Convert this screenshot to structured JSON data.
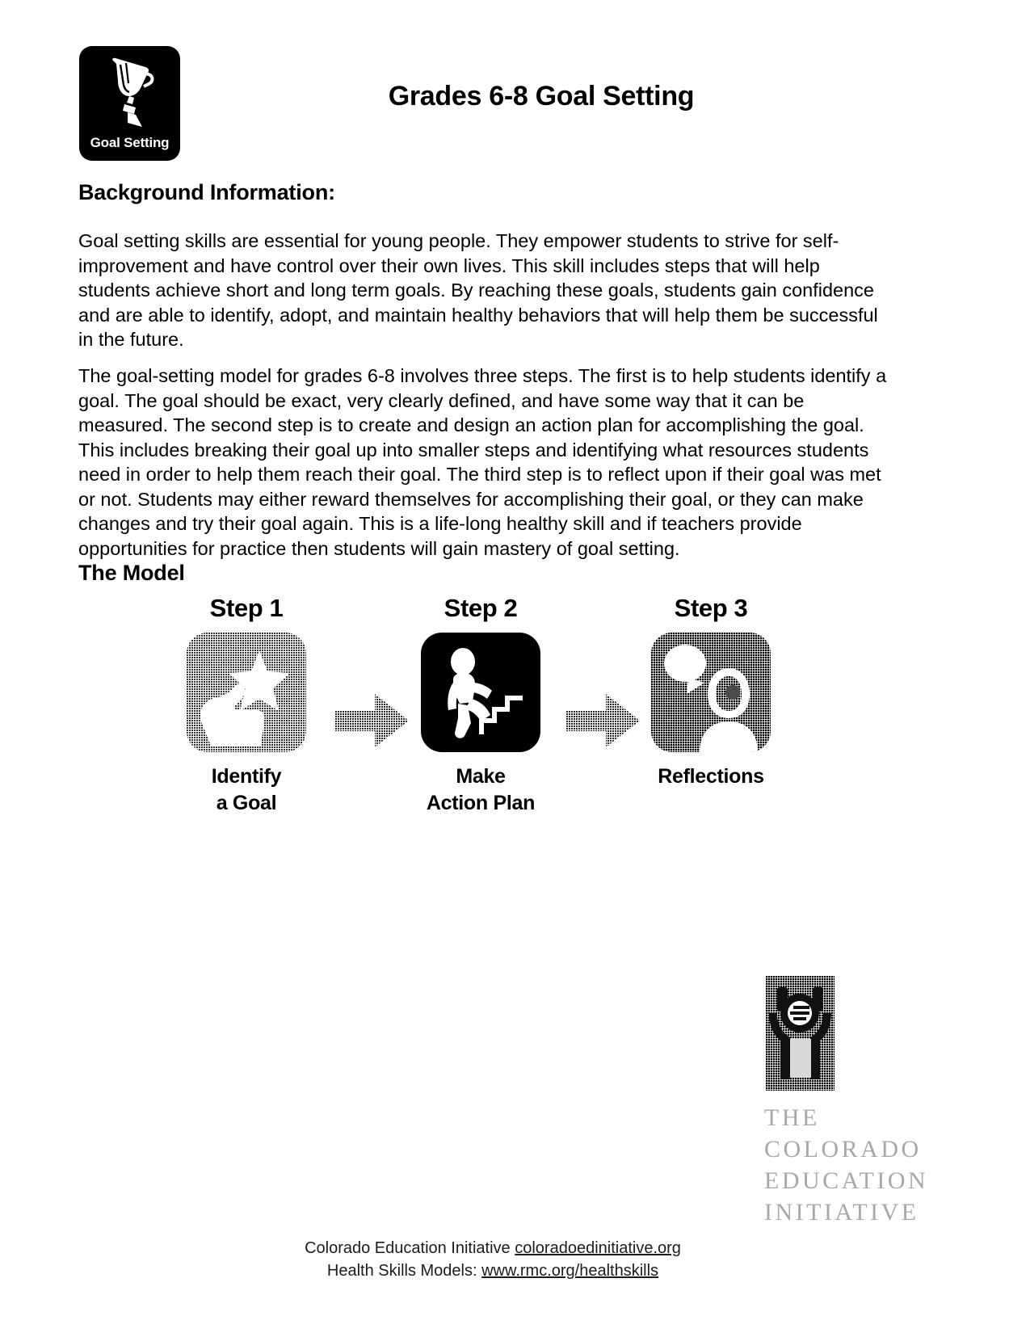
{
  "header": {
    "badge_caption": "Goal Setting",
    "badge_icon": "trophy-icon",
    "title": "Grades 6-8 Goal Setting"
  },
  "background": {
    "heading": "Background Information:",
    "paragraph_1": "Goal setting skills are essential for young people. They empower students to strive for self-improvement and have control over their own lives. This skill includes steps that will help students achieve short and long term goals. By reaching these goals, students gain confidence and are able to identify, adopt, and maintain healthy behaviors that will help them be successful in the future.",
    "paragraph_2": "The goal-setting model for grades 6-8 involves three steps. The first is to help students identify a goal. The goal should be exact, very clearly defined, and have some way that it can be measured. The second step is to create and design an action plan for accomplishing the goal. This includes breaking their goal up into smaller steps and identifying what resources students need in order to help them reach their goal. The third step is to reflect upon if their goal was met or not. Students may either reward themselves for accomplishing their goal, or they can make changes and try their goal again. This is a life-long healthy skill and if teachers provide opportunities for practice then students will gain mastery of goal setting."
  },
  "model": {
    "heading": "The Model",
    "steps": [
      {
        "title": "Step 1",
        "label_line1": "Identify",
        "label_line2": "a Goal",
        "icon": "hand-pointing-at-star-icon",
        "style": "halftone-light"
      },
      {
        "title": "Step 2",
        "label_line1": "Make",
        "label_line2": "Action Plan",
        "icon": "person-climbing-stairs-icon",
        "style": "solid-black"
      },
      {
        "title": "Step 3",
        "label_line1": "Reflections",
        "label_line2": "",
        "icon": "person-with-speech-bubble-icon",
        "style": "halftone-dark"
      }
    ],
    "arrows": [
      {
        "name": "arrow-step1-to-step2"
      },
      {
        "name": "arrow-step2-to-step3"
      }
    ]
  },
  "cei_logo": {
    "mark": "cei-emblem-icon",
    "line1": "THE",
    "line2": "COLORADO",
    "line3": "EDUCATION",
    "line4": "INITIATIVE",
    "color": "#a8a8a8"
  },
  "footer": {
    "line1_text": "Colorado Education Initiative ",
    "line1_link": "coloradoedinitiative.org",
    "line2_text": "Health Skills Models: ",
    "line2_link": "www.rmc.org/healthskills"
  }
}
